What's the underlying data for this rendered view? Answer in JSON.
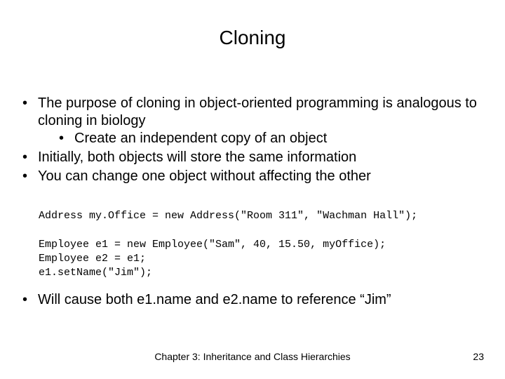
{
  "title": "Cloning",
  "bullets": {
    "b1": "The purpose of cloning in object-oriented programming is analogous to cloning in biology",
    "b1a": "Create an independent copy of an object",
    "b2": "Initially, both objects will store the same information",
    "b3": "You can change one object without affecting the other"
  },
  "code": {
    "l1": "Address my.Office = new Address(\"Room 311\", \"Wachman Hall\");",
    "l2": "",
    "l3": "Employee e1 = new Employee(\"Sam\", 40, 15.50, myOffice);",
    "l4": "Employee e2 = e1;",
    "l5": "e1.setName(\"Jim\");"
  },
  "after": {
    "b1": "Will cause both e1.name and e2.name to reference “Jim”"
  },
  "footer": {
    "center": "Chapter 3: Inheritance and Class Hierarchies",
    "page": "23"
  }
}
